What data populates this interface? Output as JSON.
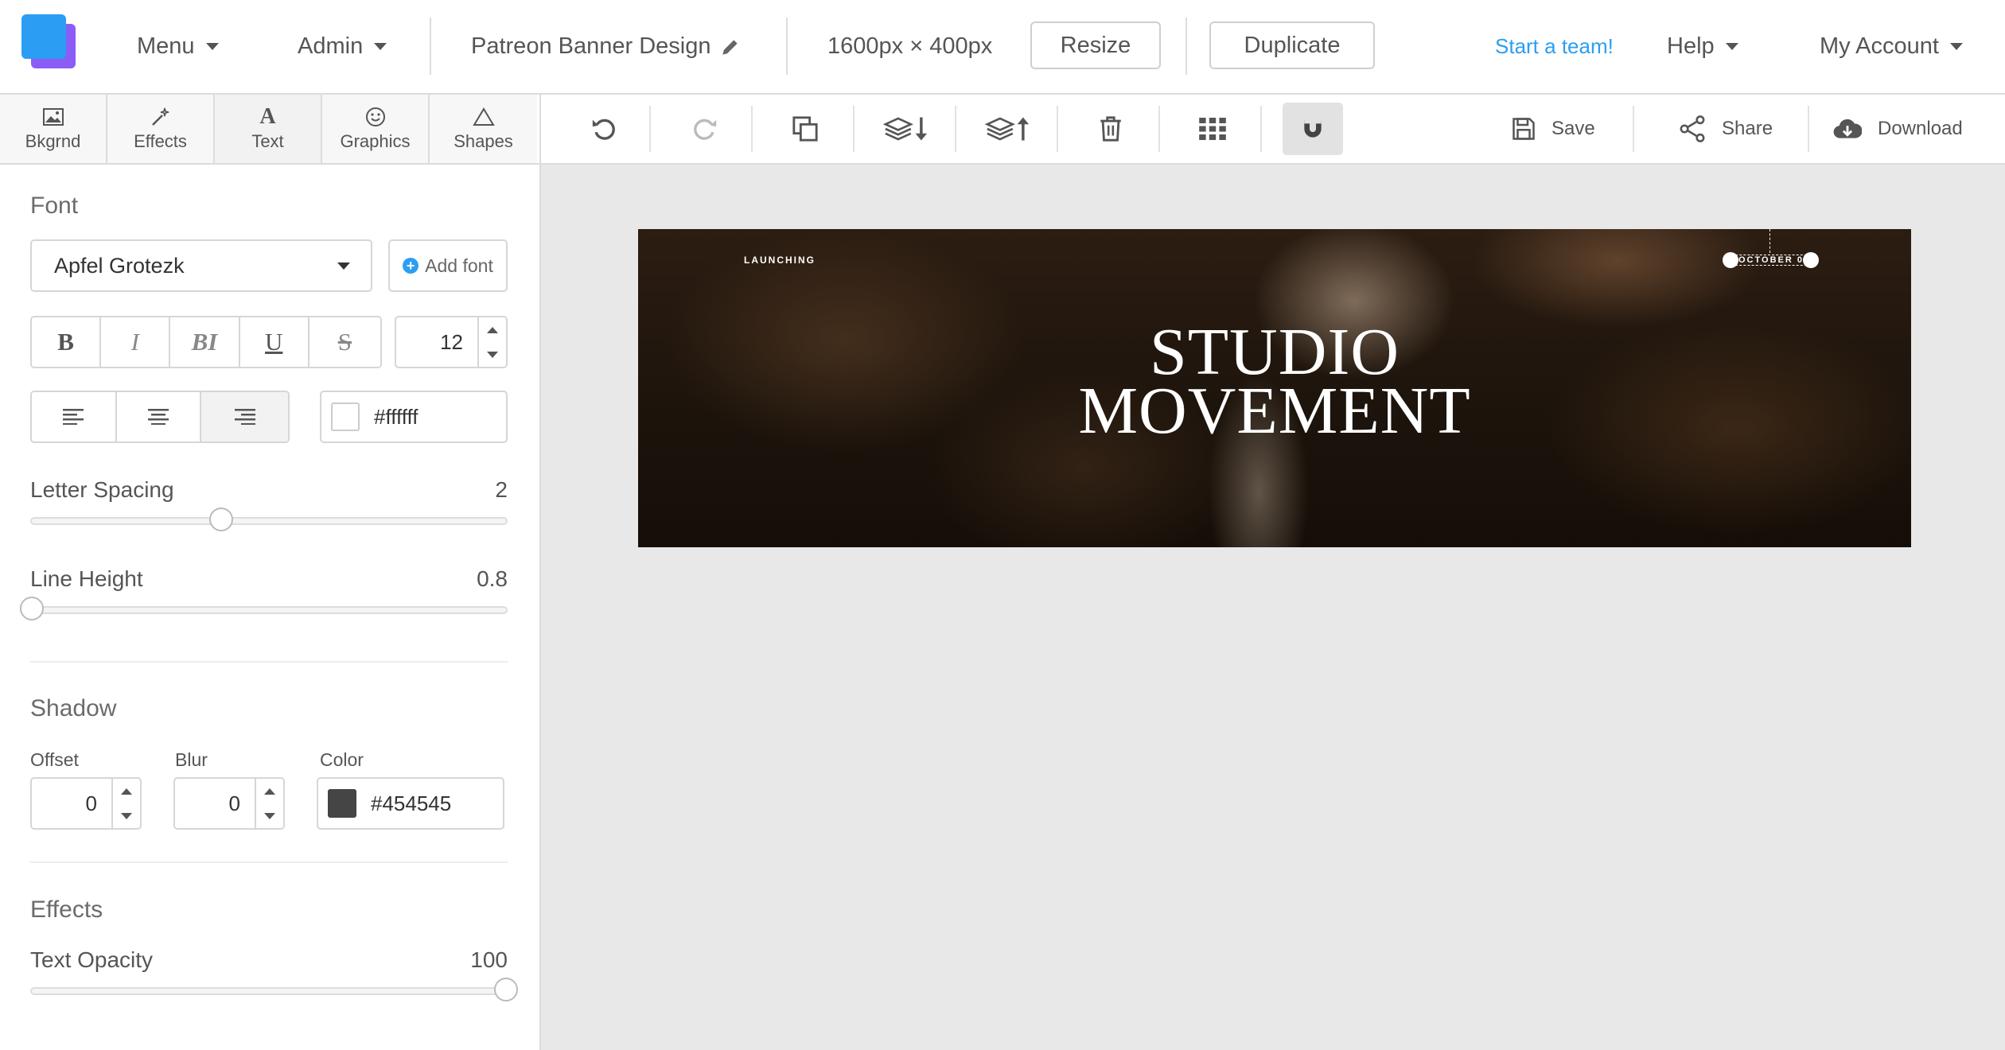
{
  "topbar": {
    "menu_label": "Menu",
    "admin_label": "Admin",
    "design_name": "Patreon Banner Design",
    "dimensions": "1600px × 400px",
    "resize_label": "Resize",
    "duplicate_label": "Duplicate",
    "start_team_label": "Start a team!",
    "help_label": "Help",
    "account_label": "My Account",
    "accent_color": "#2b9ef3"
  },
  "sidebar": {
    "tabs": [
      {
        "label": "Bkgrnd",
        "icon": "image-icon"
      },
      {
        "label": "Effects",
        "icon": "magic-wand-icon"
      },
      {
        "label": "Text",
        "icon": "text-icon"
      },
      {
        "label": "Graphics",
        "icon": "smiley-icon"
      },
      {
        "label": "Shapes",
        "icon": "triangle-icon"
      }
    ],
    "font": {
      "title": "Font",
      "selected_font": "Apfel Grotezk",
      "add_font_label": "Add font",
      "style_buttons": [
        "B",
        "I",
        "BI",
        "U",
        "S"
      ],
      "size": "12",
      "align_selected": "right",
      "color_value": "#ffffff",
      "letter_spacing_label": "Letter Spacing",
      "letter_spacing_value": "2",
      "letter_spacing_fraction": 0.4,
      "line_height_label": "Line Height",
      "line_height_value": "0.8",
      "line_height_fraction": 0.0
    },
    "shadow": {
      "title": "Shadow",
      "offset_label": "Offset",
      "offset_value": "0",
      "blur_label": "Blur",
      "blur_value": "0",
      "color_label": "Color",
      "color_value": "#454545"
    },
    "effects": {
      "title": "Effects",
      "opacity_label": "Text Opacity",
      "opacity_value": "100",
      "opacity_fraction": 1.0
    }
  },
  "toolbar": {
    "save_label": "Save",
    "share_label": "Share",
    "download_label": "Download"
  },
  "canvas": {
    "launching_text": "LAUNCHING",
    "headline_line1": "STUDIO",
    "headline_line2": "MOVEMENT",
    "date_text": "OCTOBER 0"
  }
}
